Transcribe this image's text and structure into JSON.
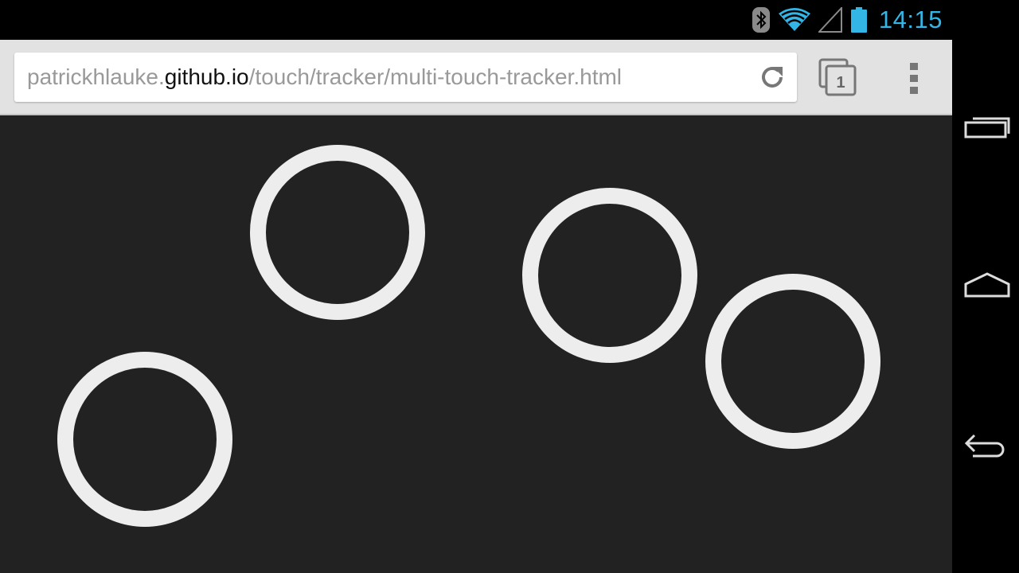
{
  "status_bar": {
    "clock": "14:15",
    "icons": [
      "bluetooth-icon",
      "wifi-icon",
      "cell-signal-icon",
      "battery-icon"
    ],
    "accent_color": "#33b5e5"
  },
  "toolbar": {
    "url": {
      "prefix": "patrickhlauke.",
      "host": "github.io",
      "path": "/touch/tracker/multi-touch-tracker.html"
    },
    "tab_count": "1",
    "icons": [
      "reload-icon",
      "tabs-icon",
      "overflow-menu-icon"
    ]
  },
  "page": {
    "background": "#222222",
    "touch_point_color": "#ededed",
    "touch_point_count": 4
  },
  "nav_bar": {
    "icons": [
      "recent-apps-icon",
      "home-icon",
      "back-icon"
    ]
  }
}
